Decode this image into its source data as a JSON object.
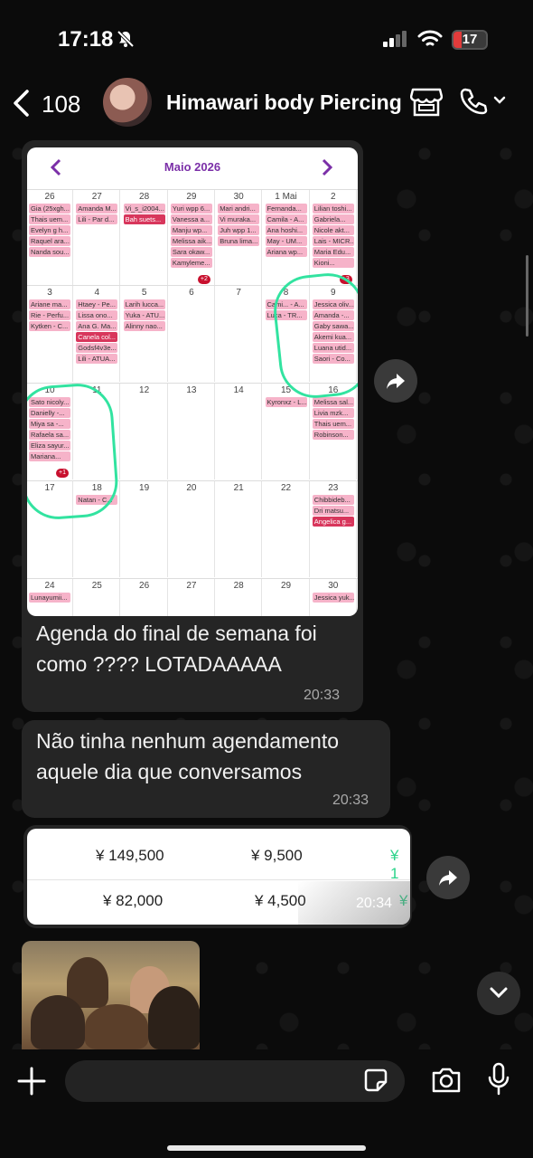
{
  "status": {
    "time": "17:18",
    "battery": "17"
  },
  "header": {
    "back_count": "108",
    "contact_name": "Himawari body Piercing"
  },
  "calendar": {
    "month": "Maio 2026",
    "weeks": [
      {
        "days": [
          {
            "num": "26",
            "events": [
              "Gia (25xgh...",
              "Thais uem...",
              "Evelyn g h...",
              "Raquel ara...",
              "Nanda sou..."
            ]
          },
          {
            "num": "27",
            "events": [
              "Amanda M...",
              "Lili - Par d..."
            ]
          },
          {
            "num": "28",
            "events": [
              "Vi_s_i2004...",
              "Bah suets..."
            ]
          },
          {
            "num": "29",
            "events": [
              "Yuri wpp 6...",
              "Vanessa a...",
              "Manju wp...",
              "Melissa aik...",
              "Sara okaw...",
              "Kamyleme..."
            ],
            "more": "+2"
          },
          {
            "num": "30",
            "events": [
              "Mari andri...",
              "Vi muraka...",
              "Juh wpp 1...",
              "Bruna lima..."
            ]
          },
          {
            "num": "1 Mai",
            "events": [
              "Fernanda...",
              "Camila - A...",
              "Ana hoshi...",
              "May - UM...",
              "Ariana wp..."
            ]
          },
          {
            "num": "2",
            "events": [
              "Lilian toshi...",
              "Gabriela...",
              "Nicole akt...",
              "Lais - MICR...",
              "Maria Edu...",
              "Kioni..."
            ],
            "more": "+3"
          }
        ]
      },
      {
        "days": [
          {
            "num": "3",
            "events": [
              "Ariane ma...",
              "Rie - Perfu...",
              "Kytken - C..."
            ]
          },
          {
            "num": "4",
            "events": [
              "Htaey - Pe...",
              "Lissa ono...",
              "Ana G. Ma...",
              "Canela col...",
              "Godsf4v3e...",
              "Lili - ATUA..."
            ]
          },
          {
            "num": "5",
            "events": [
              "Larih lucca...",
              "Yuka - ATU...",
              "Alinny nao..."
            ]
          },
          {
            "num": "6",
            "events": []
          },
          {
            "num": "7",
            "events": []
          },
          {
            "num": "8",
            "events": [
              "Cami... - A...",
              "Luca - TR..."
            ]
          },
          {
            "num": "9",
            "events": [
              "Jessica oliv...",
              "Amanda -...",
              "Gaby sawa...",
              "Akemi kua...",
              "Luana utid...",
              "Saori - Co..."
            ]
          }
        ]
      },
      {
        "days": [
          {
            "num": "10",
            "events": [
              "Sato nicoly...",
              "Danielly -...",
              "Miya sa -...",
              "Rafaela sa...",
              "Eliza sayur...",
              "Mariana..."
            ],
            "more": "+1"
          },
          {
            "num": "11",
            "events": []
          },
          {
            "num": "12",
            "events": []
          },
          {
            "num": "13",
            "events": []
          },
          {
            "num": "14",
            "events": []
          },
          {
            "num": "15",
            "events": [
              "Kyronxz - L..."
            ]
          },
          {
            "num": "16",
            "events": [
              "Melissa sal...",
              "Livia mzk...",
              "Thais uem...",
              "Robinson..."
            ]
          }
        ]
      },
      {
        "days": [
          {
            "num": "17",
            "events": []
          },
          {
            "num": "18",
            "events": [
              "Natan - C..."
            ]
          },
          {
            "num": "19",
            "events": []
          },
          {
            "num": "20",
            "events": []
          },
          {
            "num": "21",
            "events": []
          },
          {
            "num": "22",
            "events": []
          },
          {
            "num": "23",
            "events": [
              "Chibbideb...",
              "Dri matsu...",
              "Angelica g..."
            ]
          }
        ]
      },
      {
        "days": [
          {
            "num": "24",
            "events": [
              "Lunayumii..."
            ]
          },
          {
            "num": "25",
            "events": []
          },
          {
            "num": "26",
            "events": []
          },
          {
            "num": "27",
            "events": []
          },
          {
            "num": "28",
            "events": []
          },
          {
            "num": "29",
            "events": []
          },
          {
            "num": "30",
            "events": [
              "Jessica yuk..."
            ]
          }
        ]
      }
    ],
    "red_events": [
      "Bah suets...",
      "Canela col...",
      "Angelica g..."
    ]
  },
  "messages": [
    {
      "text_line1": "Agenda do final de semana foi",
      "text_line2": "como ???? LOTADAAAAA",
      "time": "20:33"
    },
    {
      "text_line1": "Não tinha nenhum agendamento",
      "text_line2": "aquele dia que conversamos",
      "time": "20:33"
    }
  ],
  "prices": {
    "row1": [
      "¥ 149,500",
      "¥ 9,500",
      "¥ 1"
    ],
    "row2": [
      "¥ 82,000",
      "¥ 4,500",
      "¥"
    ],
    "time": "20:34"
  },
  "composer": {
    "placeholder": ""
  },
  "colors": {
    "accent_green": "#32e3a0",
    "purple": "#7b2fa8",
    "event_pink": "#f6b3c9",
    "event_red": "#d8365c"
  }
}
